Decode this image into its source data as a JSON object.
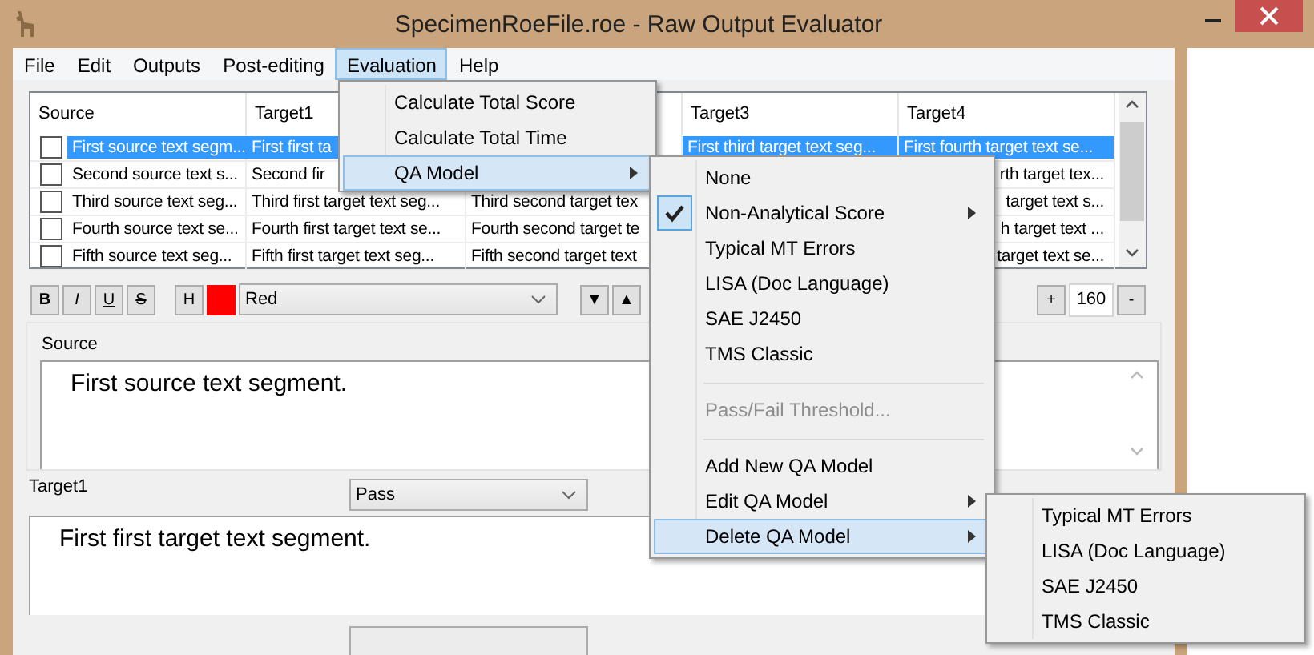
{
  "window": {
    "title": "SpecimenRoeFile.roe - Raw Output Evaluator"
  },
  "menu_bar": [
    {
      "label": "File",
      "selected": false
    },
    {
      "label": "Edit",
      "selected": false
    },
    {
      "label": "Outputs",
      "selected": false
    },
    {
      "label": "Post-editing",
      "selected": false
    },
    {
      "label": "Evaluation",
      "selected": true
    },
    {
      "label": "Help",
      "selected": false
    }
  ],
  "table": {
    "columns": [
      "Source",
      "Target1",
      null,
      "Target3",
      "Target4"
    ],
    "rows": [
      {
        "checked": false,
        "selected": true,
        "cells": [
          {
            "text": "First source text segm..."
          },
          {
            "text": "First first ta"
          },
          null,
          {
            "text": "First third target text seg..."
          },
          {
            "text": "First fourth target text se..."
          }
        ]
      },
      {
        "checked": false,
        "selected": false,
        "cells": [
          {
            "text": "Second source text s..."
          },
          {
            "text": "Second fir"
          },
          null,
          null,
          {
            "text": "rth target tex...",
            "cut_start": true
          }
        ]
      },
      {
        "checked": false,
        "selected": false,
        "cells": [
          {
            "text": "Third source text seg..."
          },
          {
            "text": "Third first target text seg..."
          },
          {
            "text": "Third second target tex"
          },
          null,
          {
            "text": "target text s...",
            "cut_start": true
          }
        ]
      },
      {
        "checked": false,
        "selected": false,
        "cells": [
          {
            "text": "Fourth source text se..."
          },
          {
            "text": "Fourth first target text se..."
          },
          {
            "text": "Fourth second target te"
          },
          null,
          {
            "text": "h target text ...",
            "cut_start": true
          }
        ]
      },
      {
        "checked": false,
        "selected": false,
        "cells": [
          {
            "text": "Fifth source text seg..."
          },
          {
            "text": "Fifth first target text seg..."
          },
          {
            "text": "Fifth second target text"
          },
          null,
          {
            "text": "target text se...",
            "cut_start": true
          }
        ]
      }
    ]
  },
  "toolbar": {
    "format_buttons": [
      {
        "label": "B",
        "kind": "bold"
      },
      {
        "label": "I",
        "kind": "italic"
      },
      {
        "label": "U",
        "kind": "underline"
      },
      {
        "label": "S",
        "kind": "strike"
      }
    ],
    "highlight_button": "H",
    "swatch": {
      "color": "#ff0000"
    },
    "color_dropdown": "Red",
    "move_buttons": [
      "▼",
      "▲"
    ],
    "zoom": {
      "plus": "+",
      "value": "160",
      "minus": "-"
    }
  },
  "source": {
    "label": "Source",
    "text": "First source text segment."
  },
  "target": {
    "label": "Target1",
    "status": "Pass",
    "text": "First first target text segment."
  },
  "evaluation_menu": [
    {
      "label": "Calculate Total Score",
      "submenu": false,
      "selected": false
    },
    {
      "label": "Calculate Total Time",
      "submenu": false,
      "selected": false
    },
    {
      "label": "QA Model",
      "submenu": true,
      "selected": true
    }
  ],
  "qa_model_menu": [
    {
      "kind": "item",
      "label": "None",
      "checked": false,
      "disabled": false,
      "submenu": false,
      "selected": false
    },
    {
      "kind": "item",
      "label": "Non-Analytical Score",
      "checked": true,
      "disabled": false,
      "submenu": true,
      "selected": false
    },
    {
      "kind": "item",
      "label": "Typical MT Errors",
      "checked": false,
      "disabled": false,
      "submenu": false,
      "selected": false
    },
    {
      "kind": "item",
      "label": "LISA (Doc Language)",
      "checked": false,
      "disabled": false,
      "submenu": false,
      "selected": false
    },
    {
      "kind": "item",
      "label": "SAE J2450",
      "checked": false,
      "disabled": false,
      "submenu": false,
      "selected": false
    },
    {
      "kind": "item",
      "label": "TMS Classic",
      "checked": false,
      "disabled": false,
      "submenu": false,
      "selected": false
    },
    {
      "kind": "separator"
    },
    {
      "kind": "item",
      "label": "Pass/Fail Threshold...",
      "checked": false,
      "disabled": true,
      "submenu": false,
      "selected": false
    },
    {
      "kind": "separator"
    },
    {
      "kind": "item",
      "label": "Add New QA Model",
      "checked": false,
      "disabled": false,
      "submenu": false,
      "selected": false
    },
    {
      "kind": "item",
      "label": "Edit QA Model",
      "checked": false,
      "disabled": false,
      "submenu": true,
      "selected": false
    },
    {
      "kind": "item",
      "label": "Delete QA Model",
      "checked": false,
      "disabled": false,
      "submenu": true,
      "selected": true
    }
  ],
  "delete_menu": [
    {
      "label": "Typical MT Errors",
      "selected": false
    },
    {
      "label": "LISA (Doc Language)",
      "selected": false
    },
    {
      "label": "SAE J2450",
      "selected": false
    },
    {
      "label": "TMS Classic",
      "selected": false
    }
  ]
}
